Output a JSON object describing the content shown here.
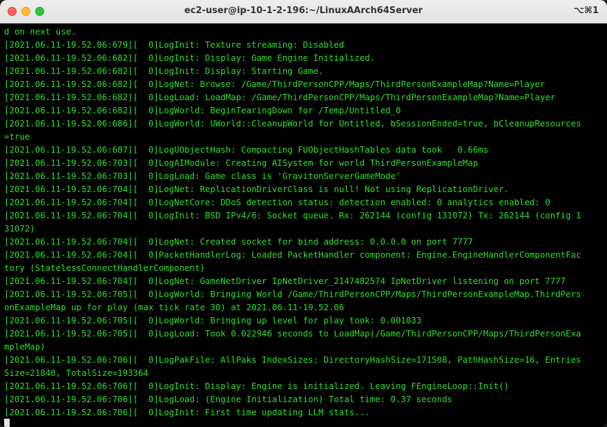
{
  "window": {
    "title": "ec2-user@ip-10-1-2-196:~/LinuxAArch64Server",
    "shortcut": "⌥⌘1"
  },
  "terminal": {
    "lines": [
      "d on next use.",
      "[2021.06.11-19.52.06:679][  0]LogInit: Texture streaming: Disabled",
      "[2021.06.11-19.52.06:682][  0]LogInit: Display: Game Engine Initialized.",
      "[2021.06.11-19.52.06:682][  0]LogInit: Display: Starting Game.",
      "[2021.06.11-19.52.06:682][  0]LogNet: Browse: /Game/ThirdPersonCPP/Maps/ThirdPersonExampleMap?Name=Player",
      "[2021.06.11-19.52.06:682][  0]LogLoad: LoadMap: /Game/ThirdPersonCPP/Maps/ThirdPersonExampleMap?Name=Player",
      "[2021.06.11-19.52.06:682][  0]LogWorld: BeginTearingDown for /Temp/Untitled_0",
      "[2021.06.11-19.52.06:686][  0]LogWorld: UWorld::CleanupWorld for Untitled, bSessionEnded=true, bCleanupResources",
      "=true",
      "[2021.06.11-19.52.06:687][  0]LogUObjectHash: Compacting FUObjectHashTables data took   0.66ms",
      "[2021.06.11-19.52.06:703][  0]LogAIModule: Creating AISystem for world ThirdPersonExampleMap",
      "[2021.06.11-19.52.06:703][  0]LogLoad: Game class is 'GravitonServerGameMode'",
      "[2021.06.11-19.52.06:704][  0]LogNet: ReplicationDriverClass is null! Not using ReplicationDriver.",
      "[2021.06.11-19.52.06:704][  0]LogNetCore: DDoS detection status: detection enabled: 0 analytics enabled: 0",
      "[2021.06.11-19.52.06:704][  0]LogInit: BSD IPv4/6: Socket queue. Rx: 262144 (config 131072) Tx: 262144 (config 1",
      "31072)",
      "[2021.06.11-19.52.06:704][  0]LogNet: Created socket for bind address: 0.0.0.0 on port 7777",
      "[2021.06.11-19.52.06:704][  0]PacketHandlerLog: Loaded PacketHandler component: Engine.EngineHandlerComponentFac",
      "tory (StatelessConnectHandlerComponent)",
      "[2021.06.11-19.52.06:704][  0]LogNet: GameNetDriver IpNetDriver_2147482574 IpNetDriver listening on port 7777",
      "[2021.06.11-19.52.06:705][  0]LogWorld: Bringing World /Game/ThirdPersonCPP/Maps/ThirdPersonExampleMap.ThirdPers",
      "onExampleMap up for play (max tick rate 30) at 2021.06.11-19.52.06",
      "[2021.06.11-19.52.06:705][  0]LogWorld: Bringing up level for play took: 0.001033",
      "[2021.06.11-19.52.06:705][  0]LogLoad: Took 0.022946 seconds to LoadMap(/Game/ThirdPersonCPP/Maps/ThirdPersonExa",
      "mpleMap)",
      "[2021.06.11-19.52.06:706][  0]LogPakFile: AllPaks IndexSizes: DirectoryHashSize=171508, PathHashSize=16, Entries",
      "Size=21840, TotalSize=193364",
      "[2021.06.11-19.52.06:706][  0]LogInit: Display: Engine is initialized. Leaving FEngineLoop::Init()",
      "[2021.06.11-19.52.06:706][  0]LogLoad: (Engine Initialization) Total time: 0.37 seconds",
      "[2021.06.11-19.52.06:706][  0]LogInit: First time updating LLM stats...",
      ""
    ]
  }
}
